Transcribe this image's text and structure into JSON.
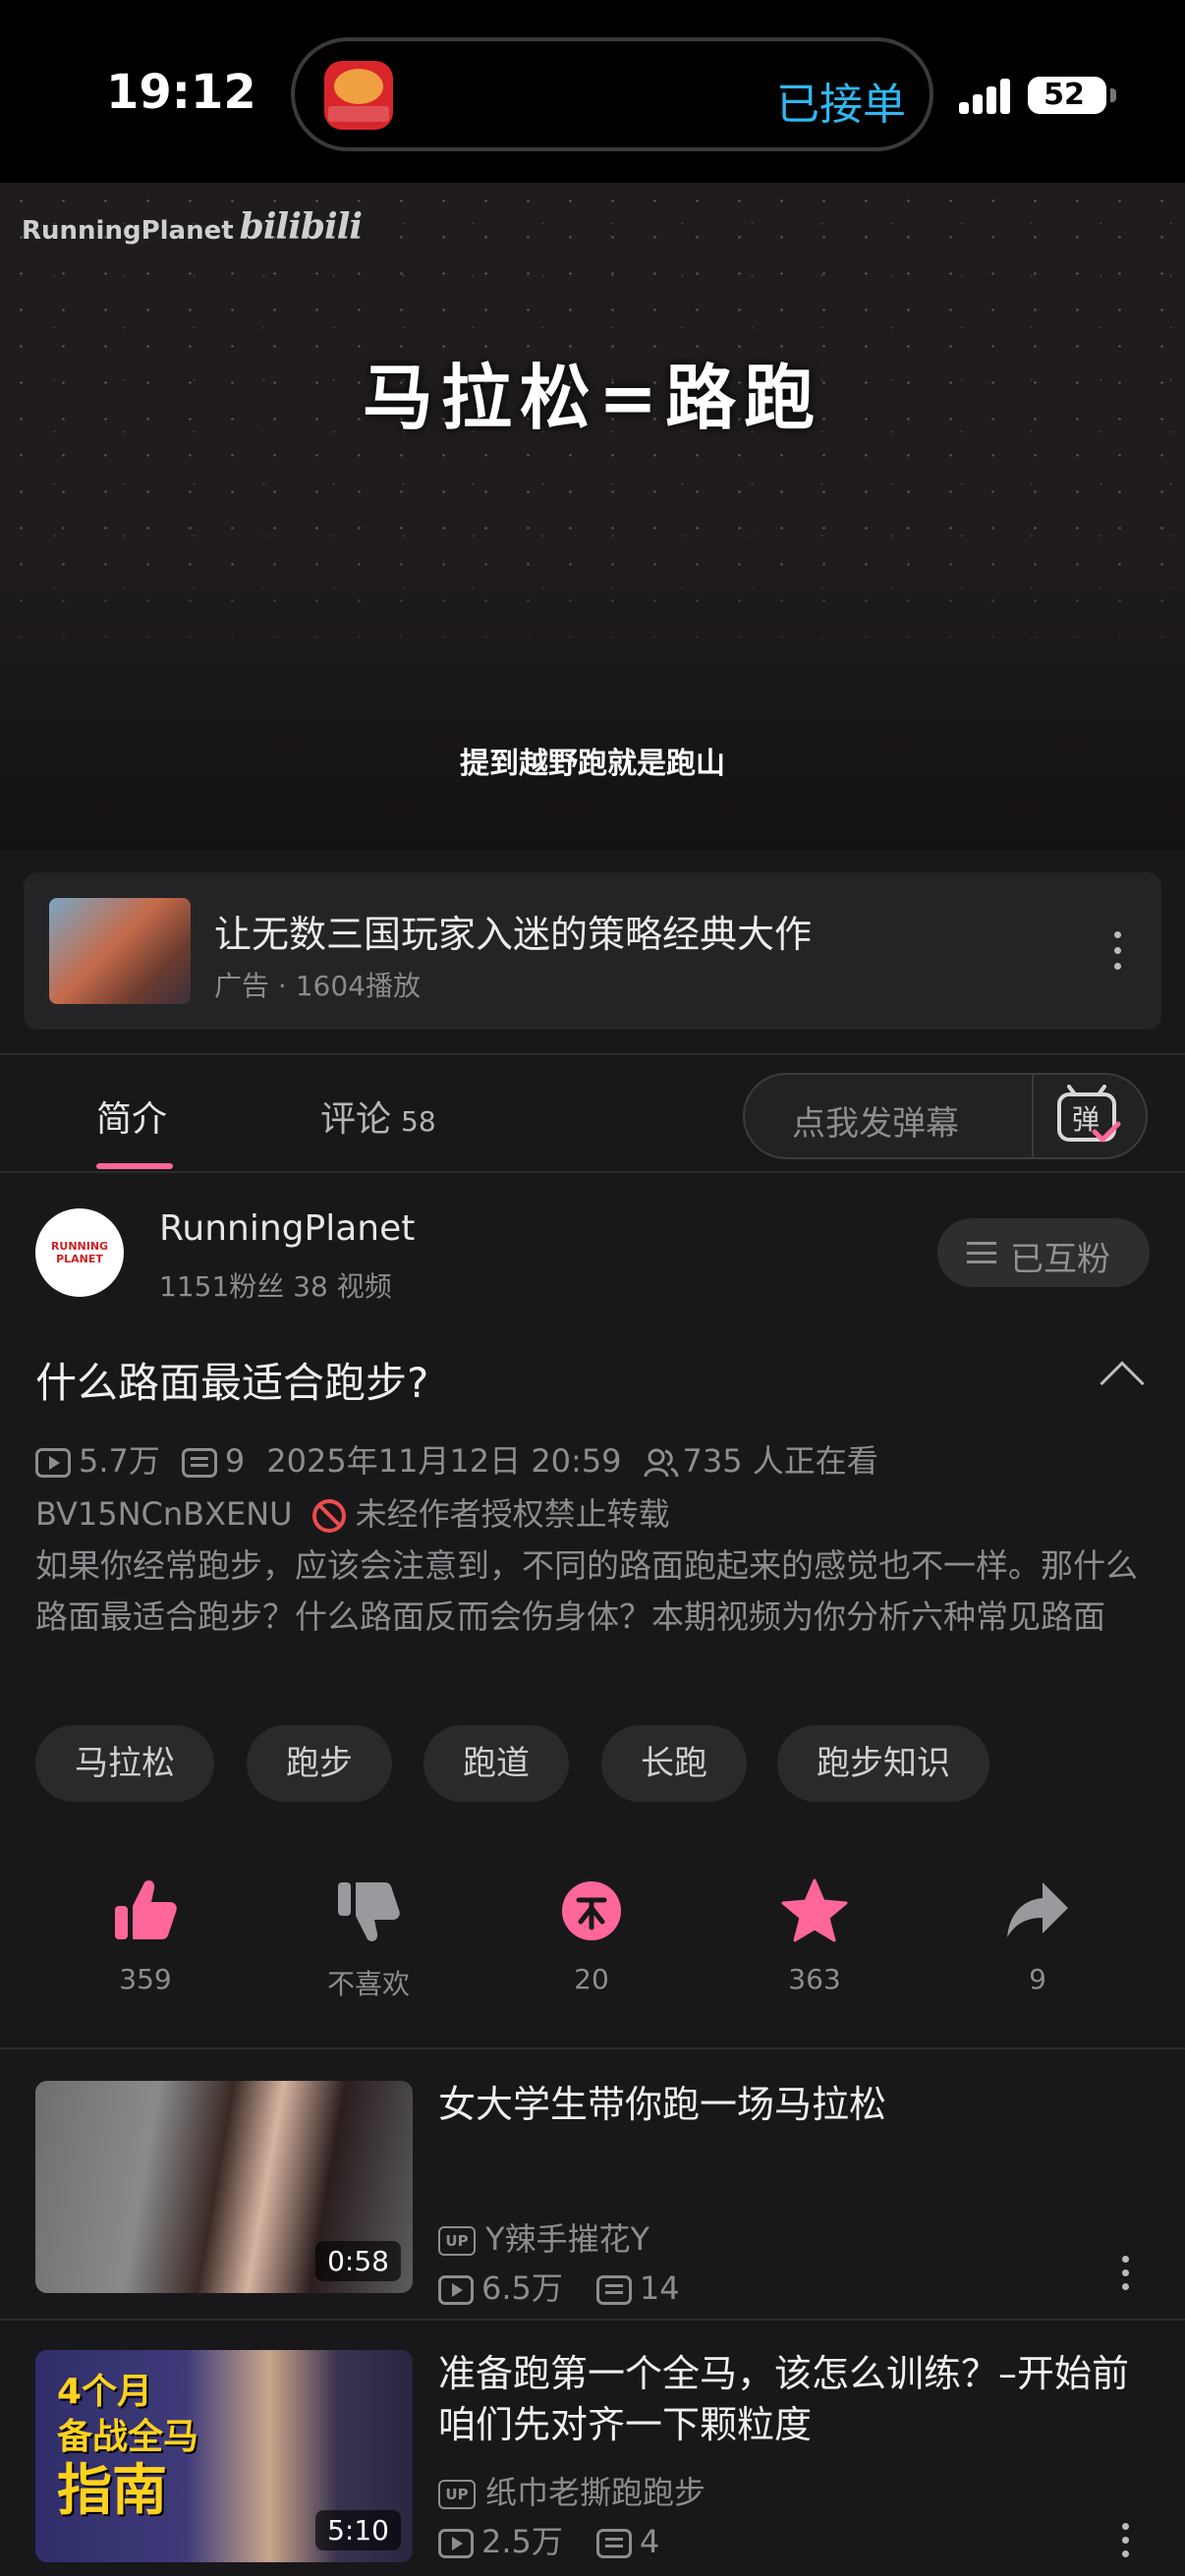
{
  "status_bar": {
    "time": "19:12",
    "island_text": "已接单",
    "battery": "52"
  },
  "video": {
    "watermark_brand": "RunningPlanet",
    "watermark_logo": "bilibili",
    "title_overlay": "马拉松=路跑",
    "subtitle": "提到越野跑就是跑山"
  },
  "ad": {
    "title": "让无数三国玩家入迷的策略经典大作",
    "meta": "广告 · 1604播放"
  },
  "tabs": {
    "intro": "简介",
    "comments": "评论",
    "comments_count": "58",
    "danmaku_placeholder": "点我发弹幕",
    "danmaku_icon_char": "弹"
  },
  "uploader": {
    "avatar_text": "RUNNING PLANET",
    "name": "RunningPlanet",
    "stats": "1151粉丝   38 视频",
    "follow_label": "已互粉"
  },
  "video_info": {
    "title": "什么路面最适合跑步?",
    "views": "5.7万",
    "danmaku": "9",
    "date": "2025年11月12日 20:59",
    "watching": "735 人正在看",
    "bvid": "BV15NCnBXENU",
    "copyright": "未经作者授权禁止转载",
    "description": "如果你经常跑步，应该会注意到，不同的路面跑起来的感觉也不一样。那什么路面最适合跑步？什么路面反而会伤身体？本期视频为你分析六种常见路面"
  },
  "tags": [
    "马拉松",
    "跑步",
    "跑道",
    "长跑",
    "跑步知识"
  ],
  "actions": [
    {
      "name": "like",
      "label": "359",
      "color": "#ff6699"
    },
    {
      "name": "dislike",
      "label": "不喜欢",
      "color": "#9a9a9e"
    },
    {
      "name": "coin",
      "label": "20",
      "color": "#ff6699"
    },
    {
      "name": "favorite",
      "label": "363",
      "color": "#ff6699"
    },
    {
      "name": "share",
      "label": "9",
      "color": "#9a9a9e"
    }
  ],
  "related": [
    {
      "title": "女大学生带你跑一场马拉松",
      "up_badge": "UP",
      "uploader": "Y辣手摧花Y",
      "views": "6.5万",
      "danmaku": "14",
      "duration": "0:58"
    },
    {
      "title": "准备跑第一个全马，该怎么训练？–开始前咱们先对齐一下颗粒度",
      "up_badge": "UP",
      "uploader": "纸巾老撕跑跑步",
      "views": "2.5万",
      "danmaku": "4",
      "duration": "5:10",
      "thumb_text_1": "4个月",
      "thumb_text_2": "备战全马",
      "thumb_text_3": "指南"
    }
  ],
  "colors": {
    "accent": "#ff6699",
    "island_text": "#2fb8f0",
    "background": "#18181a"
  }
}
